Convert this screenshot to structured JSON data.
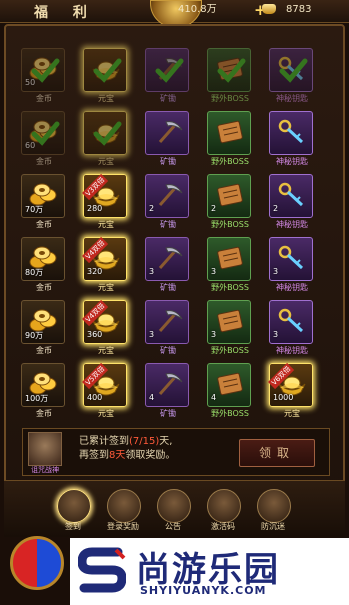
{
  "header": {
    "title": "福 利",
    "gold_amount": "410.8万",
    "ingot_amount": "8783"
  },
  "rows": [
    {
      "cells": [
        {
          "type": "gold",
          "label": "金币",
          "qty": "50",
          "claimed": true
        },
        {
          "type": "yuanbao",
          "label": "元宝",
          "qty": "",
          "claimed": true,
          "glow": true
        },
        {
          "type": "pickaxe",
          "label": "矿锄",
          "qty": "",
          "claimed": true
        },
        {
          "type": "boss",
          "label": "野外BOSS",
          "qty": "",
          "claimed": true
        },
        {
          "type": "key",
          "label": "神秘钥匙",
          "qty": "",
          "claimed": true
        }
      ]
    },
    {
      "cells": [
        {
          "type": "gold",
          "label": "金币",
          "qty": "60",
          "claimed": true
        },
        {
          "type": "yuanbao",
          "label": "元宝",
          "qty": "",
          "claimed": true,
          "glow": true
        },
        {
          "type": "pickaxe",
          "label": "矿锄",
          "qty": "",
          "claimed": false
        },
        {
          "type": "boss",
          "label": "野外BOSS",
          "qty": "",
          "claimed": false
        },
        {
          "type": "key",
          "label": "神秘钥匙",
          "qty": "",
          "claimed": false
        }
      ]
    },
    {
      "cells": [
        {
          "type": "gold",
          "label": "金币",
          "qty": "70万",
          "claimed": false
        },
        {
          "type": "yuanbao",
          "label": "元宝",
          "qty": "280",
          "claimed": false,
          "glow": true,
          "vip": "V3双倍"
        },
        {
          "type": "pickaxe",
          "label": "矿锄",
          "qty": "2",
          "claimed": false
        },
        {
          "type": "boss",
          "label": "野外BOSS",
          "qty": "2",
          "claimed": false
        },
        {
          "type": "key",
          "label": "神秘钥匙",
          "qty": "2",
          "claimed": false
        }
      ]
    },
    {
      "cells": [
        {
          "type": "gold",
          "label": "金币",
          "qty": "80万",
          "claimed": false
        },
        {
          "type": "yuanbao",
          "label": "元宝",
          "qty": "320",
          "claimed": false,
          "glow": true,
          "vip": "V4双倍"
        },
        {
          "type": "pickaxe",
          "label": "矿锄",
          "qty": "3",
          "claimed": false
        },
        {
          "type": "boss",
          "label": "野外BOSS",
          "qty": "3",
          "claimed": false
        },
        {
          "type": "key",
          "label": "神秘钥匙",
          "qty": "3",
          "claimed": false
        }
      ]
    },
    {
      "cells": [
        {
          "type": "gold",
          "label": "金币",
          "qty": "90万",
          "claimed": false
        },
        {
          "type": "yuanbao",
          "label": "元宝",
          "qty": "360",
          "claimed": false,
          "glow": true,
          "vip": "V4双倍"
        },
        {
          "type": "pickaxe",
          "label": "矿锄",
          "qty": "3",
          "claimed": false
        },
        {
          "type": "boss",
          "label": "野外BOSS",
          "qty": "3",
          "claimed": false
        },
        {
          "type": "key",
          "label": "神秘钥匙",
          "qty": "3",
          "claimed": false
        }
      ]
    },
    {
      "cells": [
        {
          "type": "gold",
          "label": "金币",
          "qty": "100万",
          "claimed": false
        },
        {
          "type": "yuanbao",
          "label": "元宝",
          "qty": "400",
          "claimed": false,
          "glow": true,
          "vip": "V5双倍"
        },
        {
          "type": "pickaxe",
          "label": "矿锄",
          "qty": "4",
          "claimed": false
        },
        {
          "type": "boss",
          "label": "野外BOSS",
          "qty": "4",
          "claimed": false
        },
        {
          "type": "yuanbao",
          "label": "元宝",
          "qty": "1000",
          "claimed": false,
          "glow": true,
          "vip": "V6双倍"
        }
      ]
    }
  ],
  "info": {
    "avatar_name": "诅咒战神",
    "line1_prefix": "已累计签到",
    "line1_count": "(7/15)",
    "line1_suffix": "天,",
    "line2_prefix": "再签到",
    "line2_days": "8天",
    "line2_suffix": "领取奖励。",
    "claim_label": "领取"
  },
  "tabs": [
    {
      "label": "签到",
      "active": true,
      "icon": "scroll-icon"
    },
    {
      "label": "登录奖励",
      "active": false,
      "icon": "gift-icon"
    },
    {
      "label": "公告",
      "active": false,
      "icon": "notice-icon"
    },
    {
      "label": "激活码",
      "active": false,
      "icon": "code-icon"
    },
    {
      "label": "防沉迷",
      "active": false,
      "icon": "mask-icon"
    }
  ],
  "banner": {
    "title": "尚游乐园",
    "url": "SHYIYUANYK.COM"
  },
  "colors": {
    "accent": "#ffe36a",
    "claimed_check": "#3fbf2a",
    "highlight": "#ff5a3a"
  }
}
